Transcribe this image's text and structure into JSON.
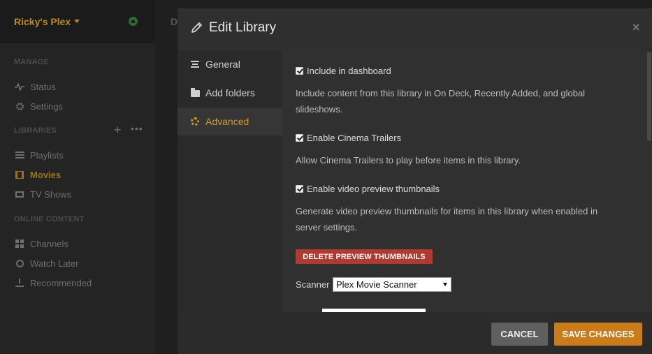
{
  "sidebar": {
    "server_name": "Ricky's Plex",
    "sections": {
      "manage": "MANAGE",
      "libraries": "LIBRARIES",
      "online": "ONLINE CONTENT"
    },
    "items": {
      "status": "Status",
      "settings": "Settings",
      "playlists": "Playlists",
      "movies": "Movies",
      "tv_shows": "TV Shows",
      "channels": "Channels",
      "watch_later": "Watch Later",
      "recommended": "Recommended"
    },
    "add_icon": "+",
    "more_icon": "•••",
    "active_item": "Movies"
  },
  "background_main": {
    "partial_text": "D"
  },
  "modal": {
    "title": "Edit Library",
    "close_glyph": "×",
    "tabs": [
      {
        "label": "General",
        "icon": "list-icon"
      },
      {
        "label": "Add folders",
        "icon": "folder-icon"
      },
      {
        "label": "Advanced",
        "icon": "gear-icon",
        "active": true
      }
    ],
    "options": {
      "dashboard": {
        "label": "Include in dashboard",
        "checked": true,
        "description": "Include content from this library in On Deck, Recently Added, and global slideshows."
      },
      "trailers": {
        "label": "Enable Cinema Trailers",
        "checked": true,
        "description": "Allow Cinema Trailers to play before items in this library."
      },
      "thumbnails": {
        "label": "Enable video preview thumbnails",
        "checked": true,
        "description": "Generate video preview thumbnails for items in this library when enabled in server settings."
      }
    },
    "delete_thumbnails_label": "DELETE PREVIEW THUMBNAILS",
    "scanner": {
      "label": "Scanner",
      "value": "Plex Movie Scanner"
    },
    "footer": {
      "cancel": "CANCEL",
      "save": "SAVE CHANGES"
    }
  },
  "colors": {
    "accent": "#cc7b19",
    "danger": "#b13a30",
    "active_tab": "#d49b26"
  }
}
